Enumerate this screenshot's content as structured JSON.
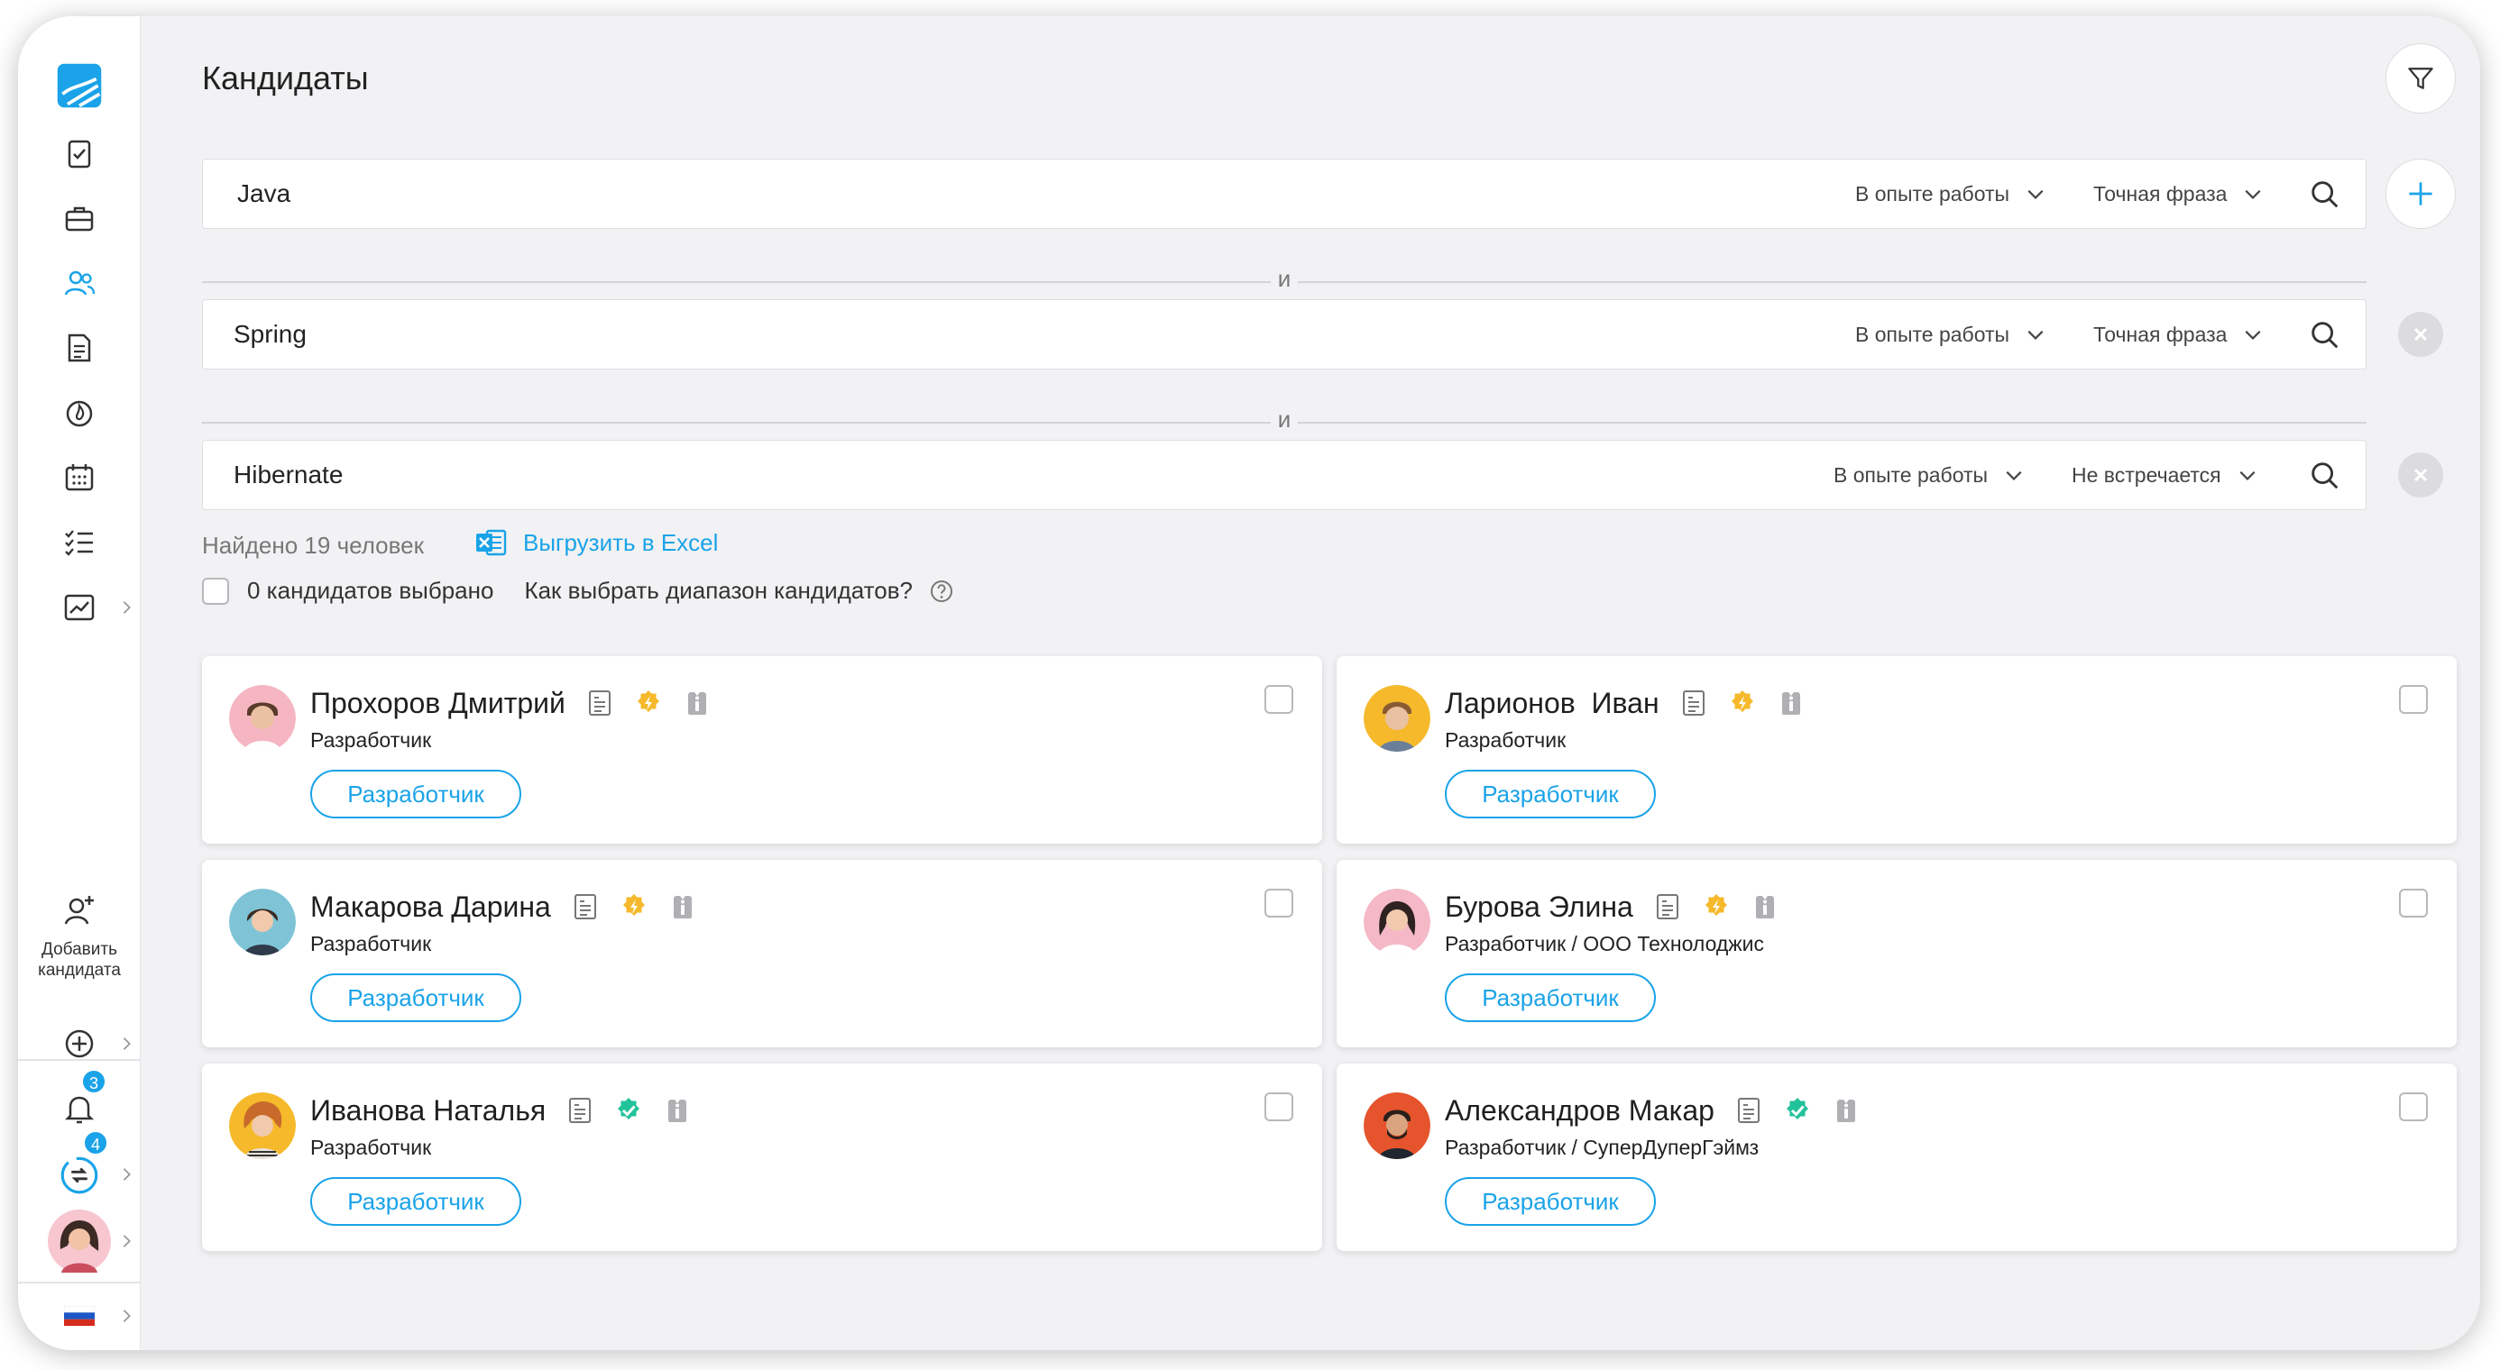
{
  "title": "Кандидаты",
  "search_rows": [
    {
      "value": "Java",
      "scope": "В опыте работы",
      "match": "Точная фраза"
    },
    {
      "value": "Spring",
      "scope": "В опыте работы",
      "match": "Точная фраза"
    },
    {
      "value": "Hibernate",
      "scope": "В опыте работы",
      "match": "Не встречается"
    }
  ],
  "and_label": "и",
  "found": "Найдено 19 человек",
  "export_label": "Выгрузить в Excel",
  "selected_label": "0 кандидатов выбрано",
  "range_help": "Как выбрать диапазон кандидатов?",
  "sidebar": {
    "add_candidate": "Добавить кандидата",
    "notifications_badge": "3",
    "messages_badge": "4"
  },
  "candidates": [
    {
      "name": "Прохоров Дмитрий",
      "role": "Разработчик",
      "tag": "Разработчик",
      "status": "flash"
    },
    {
      "name": "Ларионов  Иван",
      "role": "Разработчик",
      "tag": "Разработчик",
      "status": "flash"
    },
    {
      "name": "Макарова Дарина",
      "role": "Разработчик",
      "tag": "Разработчик",
      "status": "flash"
    },
    {
      "name": "Бурова Элина",
      "role": "Разработчик / ООО Технолоджис",
      "tag": "Разработчик",
      "status": "flash"
    },
    {
      "name": "Иванова Наталья",
      "role": "Разработчик",
      "tag": "Разработчик",
      "status": "verified"
    },
    {
      "name": "Александров Макар",
      "role": "Разработчик / СуперДуперГэймз",
      "tag": "Разработчик",
      "status": "verified"
    }
  ],
  "colors": {
    "accent": "#1aa3e8",
    "flash": "#f5b92b",
    "verified": "#22c39a",
    "muted": "#b0b0b4"
  }
}
